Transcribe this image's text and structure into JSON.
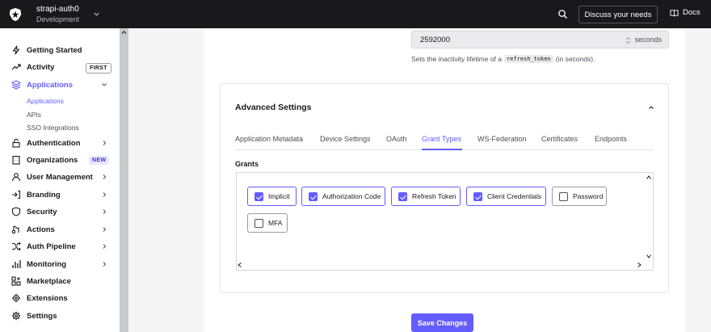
{
  "topbar": {
    "tenant_name": "strapi-auth0",
    "tenant_env": "Development",
    "discuss_label": "Discuss your needs",
    "docs_label": "Docs"
  },
  "sidebar": {
    "items": [
      {
        "label": "Getting Started",
        "icon": "lightning-icon"
      },
      {
        "label": "Activity",
        "icon": "trend-icon",
        "badge": "FIRST"
      },
      {
        "label": "Applications",
        "icon": "layers-icon",
        "active": true
      },
      {
        "label": "Authentication",
        "icon": "lock-icon"
      },
      {
        "label": "Organizations",
        "icon": "building-icon",
        "badge": "NEW"
      },
      {
        "label": "User Management",
        "icon": "user-icon"
      },
      {
        "label": "Branding",
        "icon": "sign-in-icon"
      },
      {
        "label": "Security",
        "icon": "shield-icon"
      },
      {
        "label": "Actions",
        "icon": "actions-icon"
      },
      {
        "label": "Auth Pipeline",
        "icon": "pipeline-icon"
      },
      {
        "label": "Monitoring",
        "icon": "bars-icon"
      },
      {
        "label": "Marketplace",
        "icon": "grid-plus-icon"
      },
      {
        "label": "Extensions",
        "icon": "gear-outline-icon"
      },
      {
        "label": "Settings",
        "icon": "gear-icon"
      }
    ],
    "sub_items": [
      "Applications",
      "APIs",
      "SSO Integrations"
    ]
  },
  "inactivity": {
    "value": "2592000",
    "unit": "seconds",
    "help_before": "Sets the inactivity lifetime of a",
    "help_code": "refresh_token",
    "help_after": "(in seconds)."
  },
  "advanced": {
    "title": "Advanced Settings",
    "tabs": [
      "Application Metadata",
      "Device Settings",
      "OAuth",
      "Grant Types",
      "WS-Federation",
      "Certificates",
      "Endpoints"
    ],
    "active_tab": "Grant Types",
    "grants_label": "Grants",
    "grants": [
      {
        "label": "Implicit",
        "checked": true
      },
      {
        "label": "Authorization Code",
        "checked": true
      },
      {
        "label": "Refresh Token",
        "checked": true
      },
      {
        "label": "Client Credentials",
        "checked": true
      },
      {
        "label": "Password",
        "checked": false
      },
      {
        "label": "MFA",
        "checked": false
      }
    ]
  },
  "save_label": "Save Changes",
  "colors": {
    "accent": "#635dff",
    "topbar": "#19191b"
  }
}
